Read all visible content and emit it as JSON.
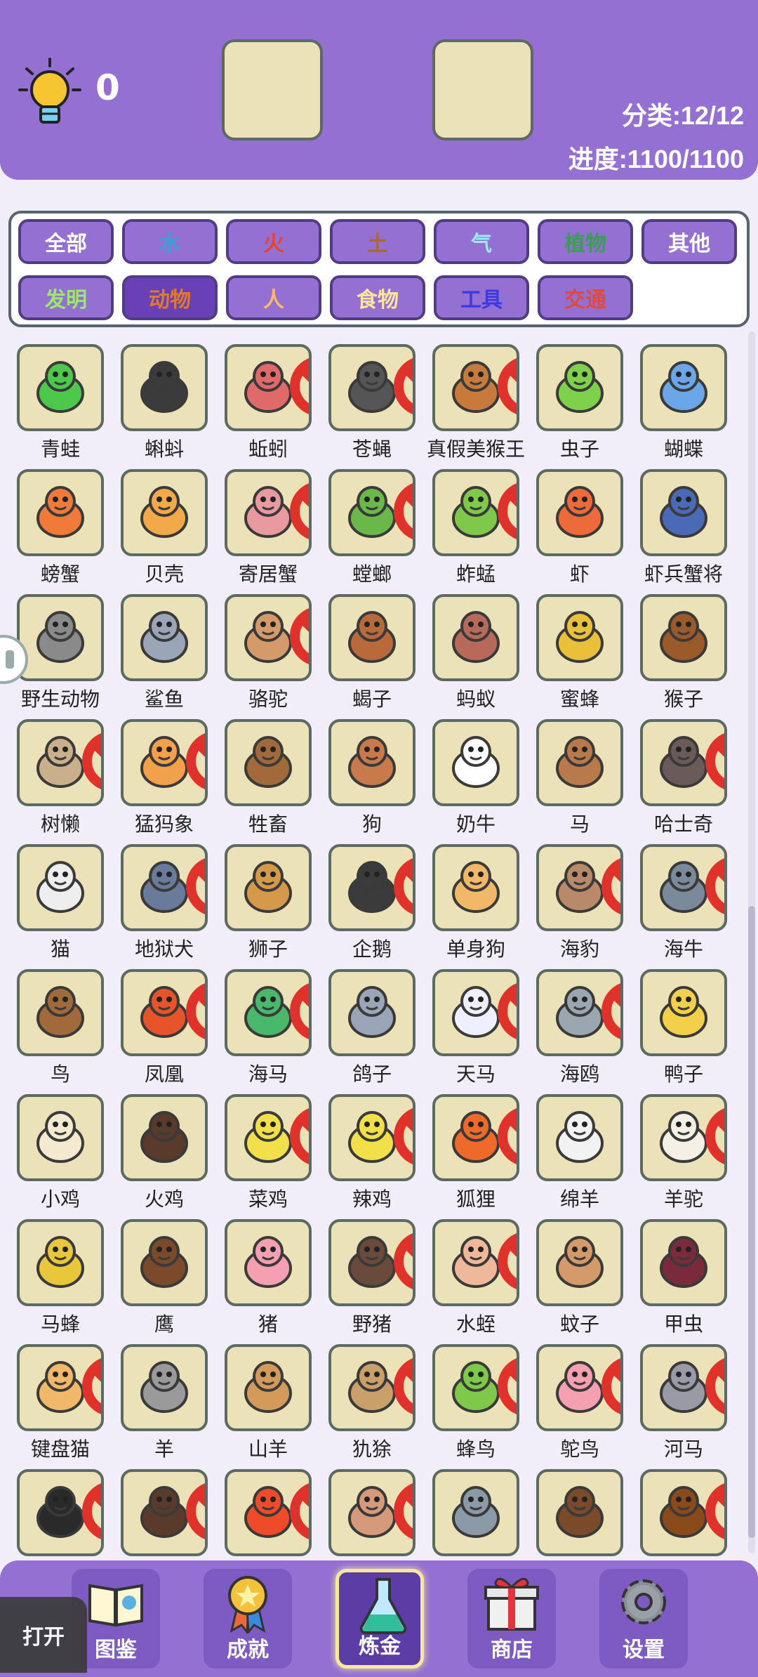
{
  "header": {
    "hint_count": "0",
    "category_stat": "分类:12/12",
    "progress_stat": "进度:1100/1100"
  },
  "categories": [
    {
      "label": "全部",
      "color": "#ffffff",
      "active": false
    },
    {
      "label": "水",
      "color": "#3aa0d8",
      "active": false
    },
    {
      "label": "火",
      "color": "#e8432f",
      "active": false
    },
    {
      "label": "土",
      "color": "#a86a2f",
      "active": false
    },
    {
      "label": "气",
      "color": "#9be8ff",
      "active": false
    },
    {
      "label": "植物",
      "color": "#3b9c55",
      "active": false
    },
    {
      "label": "其他",
      "color": "#ffffff",
      "active": false
    },
    {
      "label": "发明",
      "color": "#9be86a",
      "active": false
    },
    {
      "label": "动物",
      "color": "#e07a2a",
      "active": true
    },
    {
      "label": "人",
      "color": "#ffb86a",
      "active": false
    },
    {
      "label": "食物",
      "color": "#ffe59a",
      "active": false
    },
    {
      "label": "工具",
      "color": "#3a3ae0",
      "active": false
    },
    {
      "label": "交通",
      "color": "#e04a3a",
      "active": false
    }
  ],
  "items": [
    {
      "name": "青蛙",
      "icon": "frog-icon",
      "color": "#4cc84a",
      "locked": false
    },
    {
      "name": "蝌蚪",
      "icon": "tadpole-icon",
      "color": "#3b3b3b",
      "locked": false
    },
    {
      "name": "蚯蚓",
      "icon": "earthworm-icon",
      "color": "#e06a6a",
      "locked": true
    },
    {
      "name": "苍蝇",
      "icon": "fly-icon",
      "color": "#555555",
      "locked": true
    },
    {
      "name": "真假美猴王",
      "icon": "monkey-king-icon",
      "color": "#c77a3c",
      "locked": true
    },
    {
      "name": "虫子",
      "icon": "caterpillar-icon",
      "color": "#7ed14a",
      "locked": false
    },
    {
      "name": "蝴蝶",
      "icon": "butterfly-icon",
      "color": "#6aa6e8",
      "locked": false
    },
    {
      "name": "螃蟹",
      "icon": "crab-icon",
      "color": "#ef7a3a",
      "locked": false
    },
    {
      "name": "贝壳",
      "icon": "shell-icon",
      "color": "#f2a94a",
      "locked": false
    },
    {
      "name": "寄居蟹",
      "icon": "hermit-crab-icon",
      "color": "#e89aa0",
      "locked": true
    },
    {
      "name": "螳螂",
      "icon": "mantis-icon",
      "color": "#6bb84a",
      "locked": true
    },
    {
      "name": "蚱蜢",
      "icon": "grasshopper-icon",
      "color": "#7ec84a",
      "locked": true
    },
    {
      "name": "虾",
      "icon": "shrimp-icon",
      "color": "#ef6a3a",
      "locked": false
    },
    {
      "name": "虾兵蟹将",
      "icon": "shrimp-soldier-icon",
      "color": "#4a6ab8",
      "locked": false
    },
    {
      "name": "野生动物",
      "icon": "elephant-icon",
      "color": "#8a8a8a",
      "locked": false
    },
    {
      "name": "鲨鱼",
      "icon": "shark-icon",
      "color": "#9aa6b8",
      "locked": false
    },
    {
      "name": "骆驼",
      "icon": "camel-icon",
      "color": "#d49a6a",
      "locked": true
    },
    {
      "name": "蝎子",
      "icon": "scorpion-icon",
      "color": "#b86a3a",
      "locked": false
    },
    {
      "name": "蚂蚁",
      "icon": "ant-icon",
      "color": "#b86a5a",
      "locked": false
    },
    {
      "name": "蜜蜂",
      "icon": "bee-icon",
      "color": "#e8c03a",
      "locked": false
    },
    {
      "name": "猴子",
      "icon": "monkey-icon",
      "color": "#9a5a2a",
      "locked": false
    },
    {
      "name": "树懒",
      "icon": "sloth-icon",
      "color": "#c9b08a",
      "locked": true
    },
    {
      "name": "猛犸象",
      "icon": "mammoth-icon",
      "color": "#f2a04a",
      "locked": true
    },
    {
      "name": "牲畜",
      "icon": "ox-icon",
      "color": "#a06a3a",
      "locked": false
    },
    {
      "name": "狗",
      "icon": "dog-icon",
      "color": "#c97a4a",
      "locked": false
    },
    {
      "name": "奶牛",
      "icon": "cow-icon",
      "color": "#ffffff",
      "locked": false
    },
    {
      "name": "马",
      "icon": "horse-icon",
      "color": "#b87a4a",
      "locked": false
    },
    {
      "name": "哈士奇",
      "icon": "husky-icon",
      "color": "#6a5a5a",
      "locked": true
    },
    {
      "name": "猫",
      "icon": "cat-icon",
      "color": "#eeeeee",
      "locked": false
    },
    {
      "name": "地狱犬",
      "icon": "hellhound-icon",
      "color": "#6a7a9a",
      "locked": true
    },
    {
      "name": "狮子",
      "icon": "lion-icon",
      "color": "#d49a4a",
      "locked": false
    },
    {
      "name": "企鹅",
      "icon": "penguin-icon",
      "color": "#3b3b3b",
      "locked": true
    },
    {
      "name": "单身狗",
      "icon": "single-dog-icon",
      "color": "#f2b86a",
      "locked": false
    },
    {
      "name": "海豹",
      "icon": "seal-icon",
      "color": "#b88a6a",
      "locked": true
    },
    {
      "name": "海牛",
      "icon": "manatee-icon",
      "color": "#7a8a9a",
      "locked": true
    },
    {
      "name": "鸟",
      "icon": "bird-icon",
      "color": "#a06a3a",
      "locked": false
    },
    {
      "name": "凤凰",
      "icon": "phoenix-icon",
      "color": "#e8542a",
      "locked": true
    },
    {
      "name": "海马",
      "icon": "seahorse-icon",
      "color": "#4ab86a",
      "locked": true
    },
    {
      "name": "鸽子",
      "icon": "pigeon-icon",
      "color": "#9aa6b8",
      "locked": false
    },
    {
      "name": "天马",
      "icon": "pegasus-icon",
      "color": "#eef0ff",
      "locked": true
    },
    {
      "name": "海鸥",
      "icon": "seagull-icon",
      "color": "#9aa6b0",
      "locked": true
    },
    {
      "name": "鸭子",
      "icon": "duck-icon",
      "color": "#f2d04a",
      "locked": false
    },
    {
      "name": "小鸡",
      "icon": "chicken-icon",
      "color": "#f4ead0",
      "locked": false
    },
    {
      "name": "火鸡",
      "icon": "turkey-icon",
      "color": "#5a3a2a",
      "locked": false
    },
    {
      "name": "菜鸡",
      "icon": "chick-icon",
      "color": "#f2e04a",
      "locked": true
    },
    {
      "name": "辣鸡",
      "icon": "spicy-chick-icon",
      "color": "#f2e04a",
      "locked": true
    },
    {
      "name": "狐狸",
      "icon": "fox-icon",
      "color": "#ef6a2a",
      "locked": true
    },
    {
      "name": "绵羊",
      "icon": "sheep-icon",
      "color": "#f2f2f2",
      "locked": false
    },
    {
      "name": "羊驼",
      "icon": "alpaca-icon",
      "color": "#f4f0e4",
      "locked": true
    },
    {
      "name": "马蜂",
      "icon": "wasp-icon",
      "color": "#e8c83a",
      "locked": false
    },
    {
      "name": "鹰",
      "icon": "eagle-icon",
      "color": "#7a4a2a",
      "locked": false
    },
    {
      "name": "猪",
      "icon": "pig-icon",
      "color": "#f4a0b0",
      "locked": false
    },
    {
      "name": "野猪",
      "icon": "boar-icon",
      "color": "#6a4a3a",
      "locked": true
    },
    {
      "name": "水蛭",
      "icon": "leech-icon",
      "color": "#f0b89a",
      "locked": true
    },
    {
      "name": "蚊子",
      "icon": "mosquito-icon",
      "color": "#d49a6a",
      "locked": false
    },
    {
      "name": "甲虫",
      "icon": "beetle-icon",
      "color": "#7a2a3a",
      "locked": false
    },
    {
      "name": "键盘猫",
      "icon": "keyboard-cat-icon",
      "color": "#f2b86a",
      "locked": true
    },
    {
      "name": "羊",
      "icon": "goat-icon",
      "color": "#9a9a9a",
      "locked": false
    },
    {
      "name": "山羊",
      "icon": "mountain-goat-icon",
      "color": "#d49a5a",
      "locked": false
    },
    {
      "name": "犰狳",
      "icon": "armadillo-icon",
      "color": "#c9a06a",
      "locked": true
    },
    {
      "name": "蜂鸟",
      "icon": "hummingbird-icon",
      "color": "#7ec84a",
      "locked": true
    },
    {
      "name": "鸵鸟",
      "icon": "ostrich-icon",
      "color": "#f4a0b0",
      "locked": true
    },
    {
      "name": "河马",
      "icon": "hippo-icon",
      "color": "#9a9aa6",
      "locked": true
    },
    {
      "name": "",
      "icon": "crow-icon",
      "color": "#2a2a2a",
      "locked": true
    },
    {
      "name": "",
      "icon": "yak-icon",
      "color": "#5a3a2a",
      "locked": true
    },
    {
      "name": "",
      "icon": "lobster-icon",
      "color": "#ef4a2a",
      "locked": true
    },
    {
      "name": "",
      "icon": "snail-icon",
      "color": "#d49a7a",
      "locked": true
    },
    {
      "name": "",
      "icon": "wolf-icon",
      "color": "#8a9aa6",
      "locked": false
    },
    {
      "name": "",
      "icon": "beaver-icon",
      "color": "#7a4a2a",
      "locked": false
    },
    {
      "name": "",
      "icon": "owl-icon",
      "color": "#8a4a1a",
      "locked": true
    }
  ],
  "nav": [
    {
      "label": "图鉴",
      "icon": "book-icon",
      "active": false
    },
    {
      "label": "成就",
      "icon": "medal-icon",
      "active": false
    },
    {
      "label": "炼金",
      "icon": "flask-icon",
      "active": true
    },
    {
      "label": "商店",
      "icon": "gift-icon",
      "active": false
    },
    {
      "label": "设置",
      "icon": "gear-icon",
      "active": false
    }
  ],
  "open_button": "打开"
}
